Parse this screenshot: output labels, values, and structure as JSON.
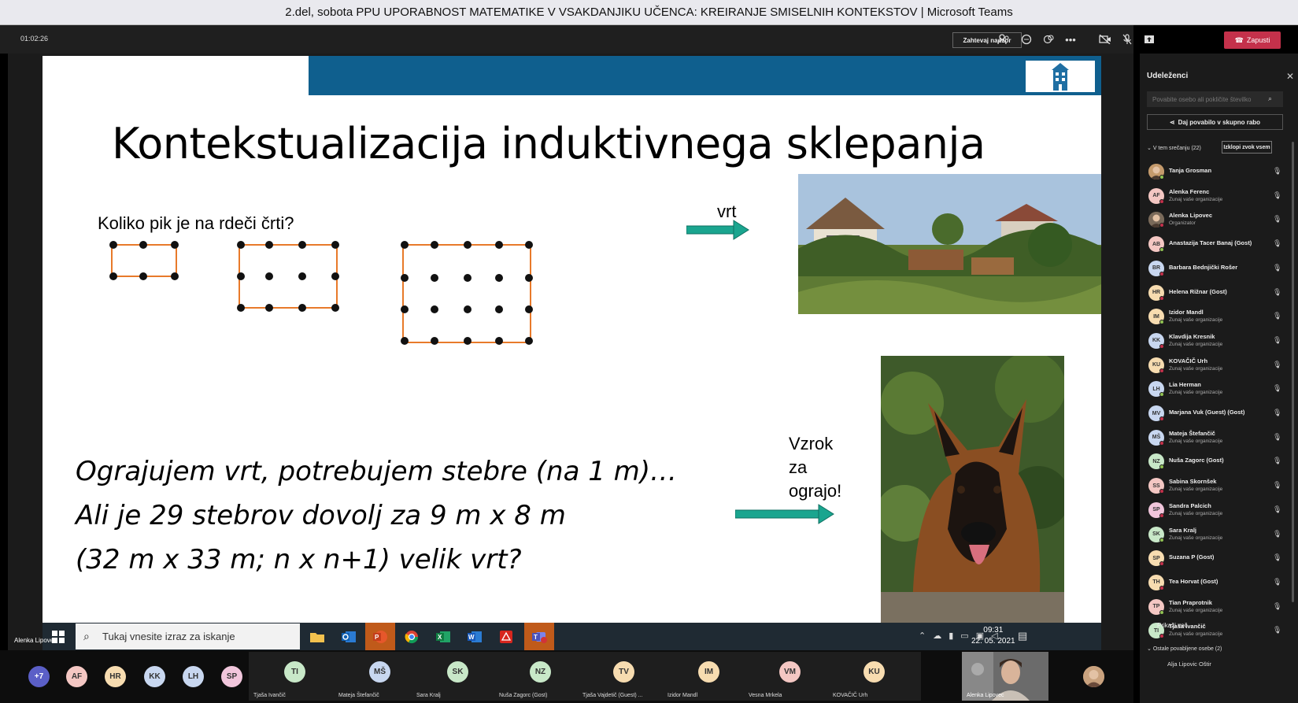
{
  "window": {
    "title": "2.del, sobota PPU UPORABNOST MATEMATIKE V VSAKDANJIKU UČENCA: KREIRANJE SMISELNIH KONTEKSTOV | Microsoft Teams"
  },
  "meeting": {
    "timer": "01:02:26",
    "request_control": "Zahtevaj nadzor",
    "leave": "Zapusti",
    "presenter": "Alenka Lipovec"
  },
  "slide": {
    "title": "Kontekstualizacija induktivnega sklepanja",
    "question": "Koliko pik je na rdeči črti?",
    "label_garden": "vrt",
    "label_reason": [
      "Vzrok",
      "za",
      "ograjo!"
    ],
    "lines": [
      "Ograjujem vrt, potrebujem stebre (na 1 m)…",
      "Ali je 29 stebrov dovolj za 9 m x 8 m",
      "(32 m x 33 m; n x n+1) velik vrt?"
    ]
  },
  "taskbar": {
    "search_placeholder": "Tukaj vnesite izraz za iskanje",
    "time": "09:31",
    "date": "22. 05. 2021"
  },
  "gallery": {
    "overflow_count": "+7",
    "avatars": [
      {
        "initials": "AF",
        "color": "#f4c7c3"
      },
      {
        "initials": "HR",
        "color": "#f7dcb0"
      },
      {
        "initials": "KK",
        "color": "#c8d7f0"
      },
      {
        "initials": "LH",
        "color": "#c8d7f0"
      },
      {
        "initials": "SP",
        "color": "#f1c6dc"
      }
    ],
    "tiles": [
      {
        "initials": "TI",
        "name": "Tjaša Ivančič",
        "color": "#c8e8c8"
      },
      {
        "initials": "MŠ",
        "name": "Mateja Štefančič",
        "color": "#c8d7f0"
      },
      {
        "initials": "SK",
        "name": "Sara Kralj",
        "color": "#c8e8c8"
      },
      {
        "initials": "NZ",
        "name": "Nuša Zagorc (Gost)",
        "color": "#c8e8c8"
      },
      {
        "initials": "TV",
        "name": "Tjaša Vajdetič (Guest) ...",
        "color": "#f7dcb0"
      },
      {
        "initials": "IM",
        "name": "Izidor Mandl",
        "color": "#f7dcb0"
      },
      {
        "initials": "VM",
        "name": "Vesna Mrkela",
        "color": "#f4c7c3"
      },
      {
        "initials": "KU",
        "name": "KOVAČIČ Urh",
        "color": "#f7dcb0"
      }
    ],
    "self_name": "Alenka Lipovec"
  },
  "panel": {
    "title": "Udeleženci",
    "search_placeholder": "Povabite osebo ali pokličite številko",
    "invite": "Daj povabilo v skupno rabo",
    "section": "V tem srečanju (22)",
    "mute_all": "Izklopi zvok vsem",
    "show_more": "Prikaži več",
    "others_section": "Ostale povabljene osebe (2)",
    "last_person": "Alja Lipovic Oštir",
    "participants": [
      {
        "initials": "",
        "name": "Tanja Grosman",
        "sub": "",
        "color": "#c49a6c",
        "photo": true
      },
      {
        "initials": "AF",
        "name": "Alenka Ferenc",
        "sub": "Zunaj vaše organizacije",
        "color": "#f4c7c3"
      },
      {
        "initials": "",
        "name": "Alenka Lipovec",
        "sub": "Organizator",
        "color": "#7a6a5a",
        "photo": true
      },
      {
        "initials": "AB",
        "name": "Anastazija Tacer Banaj (Gost)",
        "sub": "",
        "color": "#f4c7c3"
      },
      {
        "initials": "BR",
        "name": "Barbara Bednjički Rošer",
        "sub": "",
        "color": "#c8d7f0"
      },
      {
        "initials": "HR",
        "name": "Helena Rižnar (Gost)",
        "sub": "",
        "color": "#f7dcb0"
      },
      {
        "initials": "IM",
        "name": "Izidor Mandl",
        "sub": "Zunaj vaše organizacije",
        "color": "#f7dcb0"
      },
      {
        "initials": "KK",
        "name": "Klavdija Kresnik",
        "sub": "Zunaj vaše organizacije",
        "color": "#c8d7f0"
      },
      {
        "initials": "KU",
        "name": "KOVAČIČ Urh",
        "sub": "Zunaj vaše organizacije",
        "color": "#f7dcb0"
      },
      {
        "initials": "LH",
        "name": "Lia Herman",
        "sub": "Zunaj vaše organizacije",
        "color": "#c8d7f0"
      },
      {
        "initials": "MV",
        "name": "Marjana Vuk (Guest) (Gost)",
        "sub": "",
        "color": "#c8d7f0"
      },
      {
        "initials": "MŠ",
        "name": "Mateja Štefančič",
        "sub": "Zunaj vaše organizacije",
        "color": "#c8d7f0"
      },
      {
        "initials": "NZ",
        "name": "Nuša Zagorc (Gost)",
        "sub": "",
        "color": "#c8e8c8"
      },
      {
        "initials": "SS",
        "name": "Sabina Skornšek",
        "sub": "Zunaj vaše organizacije",
        "color": "#f4c7c3"
      },
      {
        "initials": "SP",
        "name": "Sandra Palcich",
        "sub": "Zunaj vaše organizacije",
        "color": "#f1c6dc"
      },
      {
        "initials": "SK",
        "name": "Sara Kralj",
        "sub": "Zunaj vaše organizacije",
        "color": "#c8e8c8"
      },
      {
        "initials": "SP",
        "name": "Suzana P (Gost)",
        "sub": "",
        "color": "#f7dcb0"
      },
      {
        "initials": "TH",
        "name": "Tea Horvat (Gost)",
        "sub": "",
        "color": "#f7dcb0"
      },
      {
        "initials": "TP",
        "name": "Tian Praprotnik",
        "sub": "Zunaj vaše organizacije",
        "color": "#f4c7c3"
      },
      {
        "initials": "TI",
        "name": "Tjaša Ivančič",
        "sub": "Zunaj vaše organizacije",
        "color": "#c8e8c8"
      }
    ]
  }
}
